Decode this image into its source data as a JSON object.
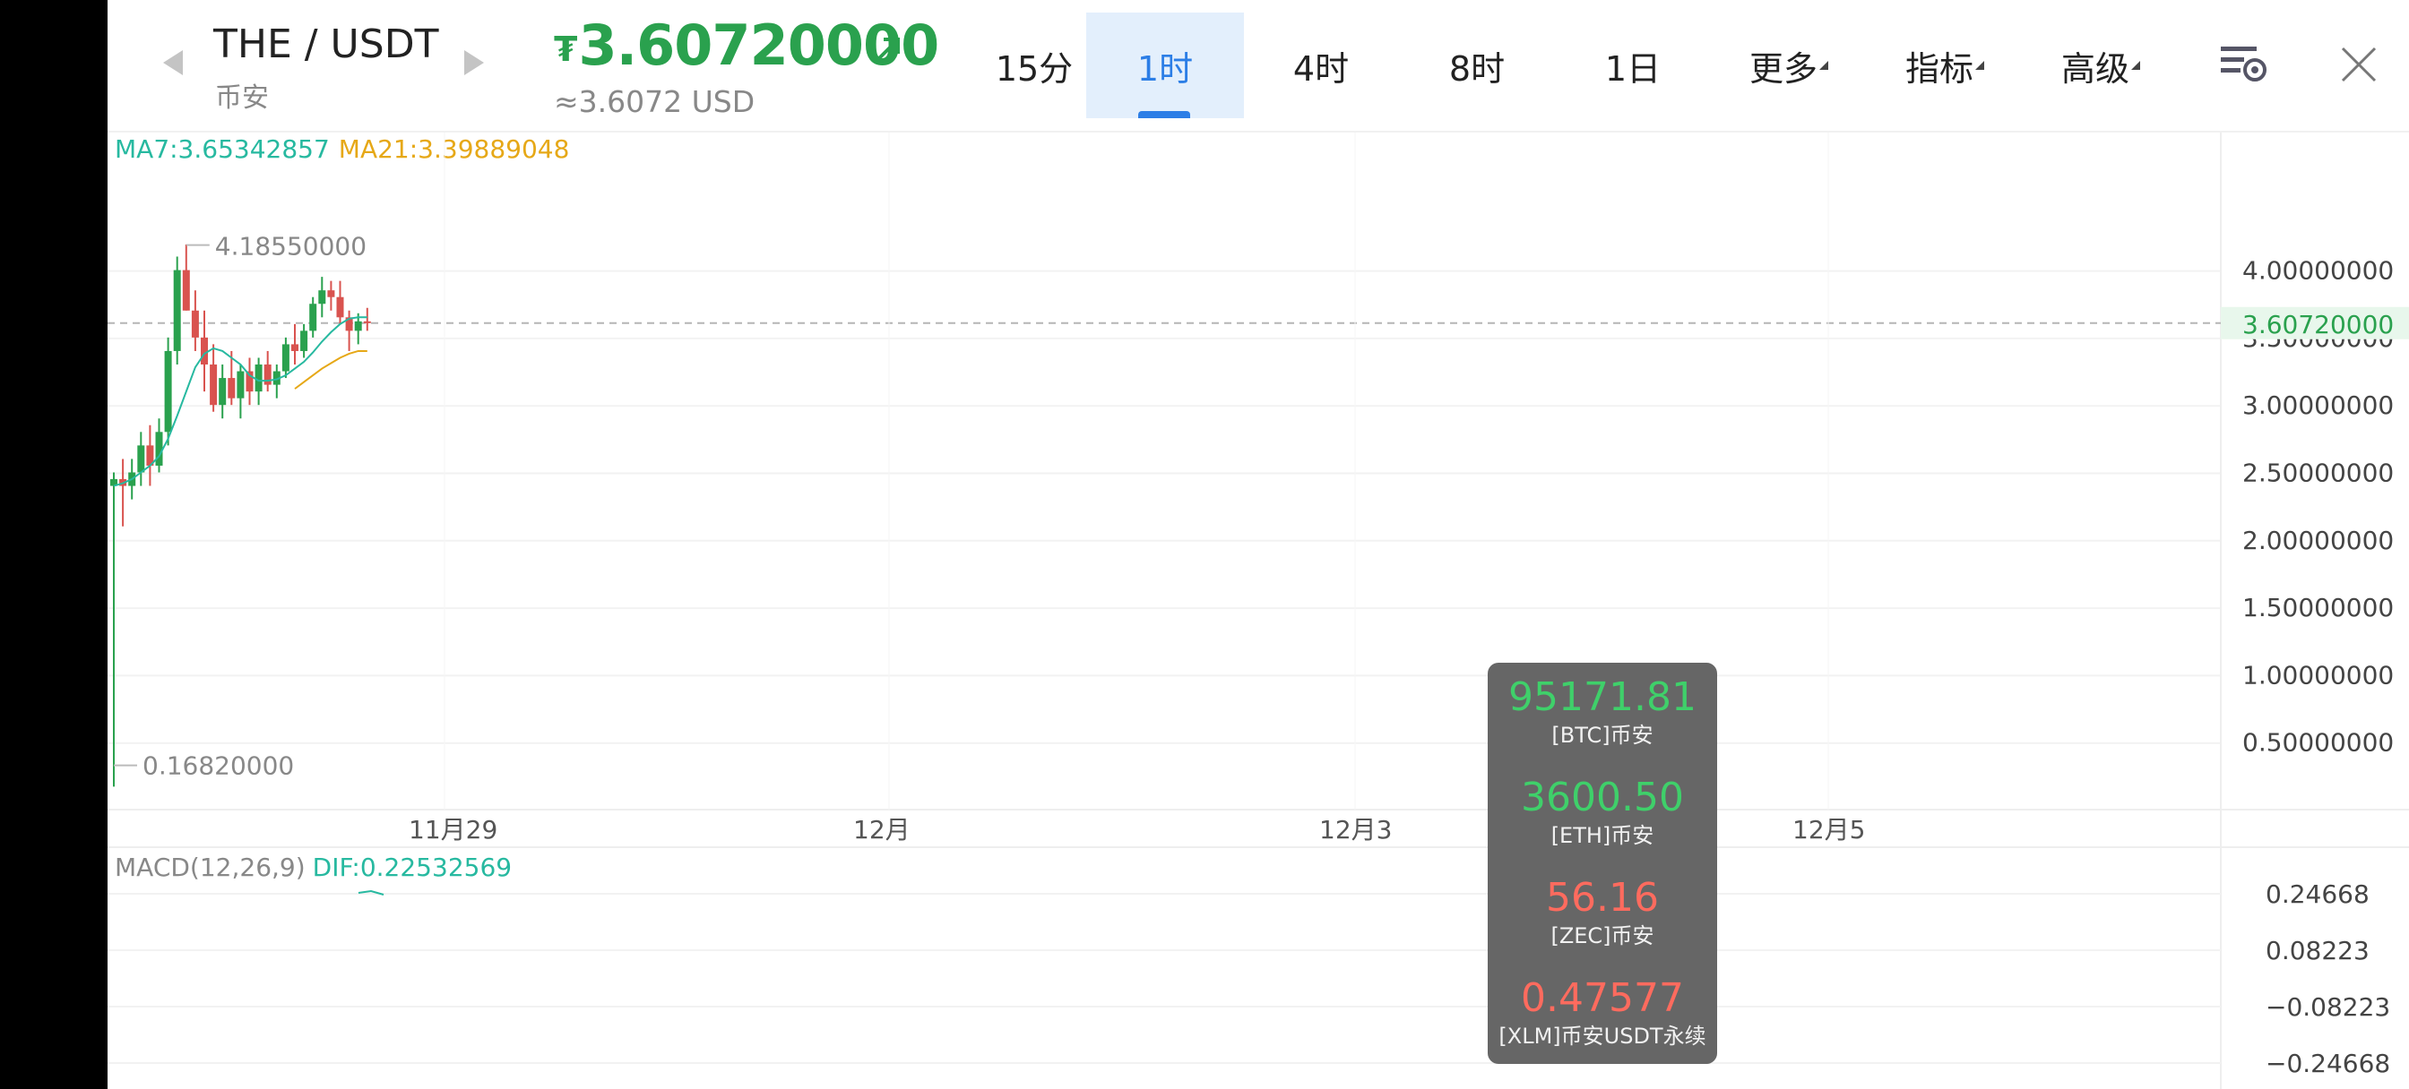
{
  "header": {
    "pair": "THE / USDT",
    "exchange": "币安",
    "price_symbol": "₮",
    "price": "3.60720000",
    "price_usd": "≈3.6072 USD"
  },
  "timeframes": [
    {
      "label": "15分",
      "active": false
    },
    {
      "label": "1时",
      "active": true
    },
    {
      "label": "4时",
      "active": false
    },
    {
      "label": "8时",
      "active": false
    },
    {
      "label": "1日",
      "active": false
    }
  ],
  "menus": {
    "more": "更多",
    "indicators": "指标",
    "advanced": "高级"
  },
  "icons": {
    "settings": "chart-settings-icon",
    "close": "close-icon",
    "prev": "prev-pair-icon",
    "next": "next-pair-icon",
    "trend": "trend-up-arrow-icon"
  },
  "indicators": {
    "ma7": "MA7:3.65342857",
    "ma21": "MA21:3.39889048",
    "macd": "MACD(12,26,9)",
    "dif": "DIF:0.22532569"
  },
  "chart_data": {
    "type": "candlestick",
    "price_axis": {
      "ticks": [
        "4.00000000",
        "3.50000000",
        "3.00000000",
        "2.50000000",
        "2.00000000",
        "1.50000000",
        "1.00000000",
        "0.50000000"
      ],
      "current": "3.60720000"
    },
    "high_label": "4.18550000",
    "low_label": "0.16820000",
    "x_labels": [
      "11月29",
      "12月",
      "12月3",
      "12月5"
    ],
    "macd_axis": [
      "0.24668",
      "0.08223",
      "−0.08223",
      "−0.24668"
    ],
    "colors": {
      "up": "#2aa14e",
      "down": "#d9534f",
      "ma7": "#27b9a0",
      "ma21": "#e6a817"
    },
    "candles": [
      {
        "o": 2.4,
        "h": 2.5,
        "l": 0.17,
        "c": 2.45
      },
      {
        "o": 2.45,
        "h": 2.6,
        "l": 2.1,
        "c": 2.4
      },
      {
        "o": 2.4,
        "h": 2.6,
        "l": 2.3,
        "c": 2.5
      },
      {
        "o": 2.5,
        "h": 2.8,
        "l": 2.4,
        "c": 2.7
      },
      {
        "o": 2.7,
        "h": 2.85,
        "l": 2.4,
        "c": 2.55
      },
      {
        "o": 2.55,
        "h": 2.9,
        "l": 2.5,
        "c": 2.8
      },
      {
        "o": 2.8,
        "h": 3.5,
        "l": 2.7,
        "c": 3.4
      },
      {
        "o": 3.4,
        "h": 4.1,
        "l": 3.3,
        "c": 4.0
      },
      {
        "o": 4.0,
        "h": 4.19,
        "l": 3.7,
        "c": 3.7
      },
      {
        "o": 3.7,
        "h": 3.85,
        "l": 3.4,
        "c": 3.5
      },
      {
        "o": 3.5,
        "h": 3.7,
        "l": 3.1,
        "c": 3.3
      },
      {
        "o": 3.3,
        "h": 3.45,
        "l": 2.95,
        "c": 3.0
      },
      {
        "o": 3.0,
        "h": 3.3,
        "l": 2.9,
        "c": 3.2
      },
      {
        "o": 3.2,
        "h": 3.4,
        "l": 3.0,
        "c": 3.05
      },
      {
        "o": 3.05,
        "h": 3.3,
        "l": 2.9,
        "c": 3.25
      },
      {
        "o": 3.25,
        "h": 3.35,
        "l": 3.0,
        "c": 3.1
      },
      {
        "o": 3.1,
        "h": 3.35,
        "l": 3.0,
        "c": 3.3
      },
      {
        "o": 3.3,
        "h": 3.4,
        "l": 3.1,
        "c": 3.15
      },
      {
        "o": 3.15,
        "h": 3.3,
        "l": 3.05,
        "c": 3.25
      },
      {
        "o": 3.25,
        "h": 3.5,
        "l": 3.2,
        "c": 3.45
      },
      {
        "o": 3.45,
        "h": 3.6,
        "l": 3.3,
        "c": 3.4
      },
      {
        "o": 3.4,
        "h": 3.6,
        "l": 3.35,
        "c": 3.55
      },
      {
        "o": 3.55,
        "h": 3.8,
        "l": 3.5,
        "c": 3.75
      },
      {
        "o": 3.75,
        "h": 3.95,
        "l": 3.65,
        "c": 3.85
      },
      {
        "o": 3.85,
        "h": 3.92,
        "l": 3.7,
        "c": 3.8
      },
      {
        "o": 3.8,
        "h": 3.92,
        "l": 3.6,
        "c": 3.65
      },
      {
        "o": 3.65,
        "h": 3.7,
        "l": 3.4,
        "c": 3.55
      },
      {
        "o": 3.55,
        "h": 3.68,
        "l": 3.45,
        "c": 3.62
      },
      {
        "o": 3.62,
        "h": 3.72,
        "l": 3.55,
        "c": 3.61
      }
    ],
    "ma7": [
      2.4,
      2.42,
      2.45,
      2.5,
      2.55,
      2.62,
      2.75,
      2.92,
      3.1,
      3.28,
      3.38,
      3.42,
      3.4,
      3.35,
      3.3,
      3.22,
      3.18,
      3.18,
      3.19,
      3.22,
      3.27,
      3.32,
      3.39,
      3.47,
      3.54,
      3.6,
      3.64,
      3.65,
      3.65
    ],
    "ma21": [
      null,
      null,
      null,
      null,
      null,
      null,
      null,
      null,
      null,
      null,
      null,
      null,
      null,
      null,
      null,
      null,
      null,
      null,
      null,
      null,
      3.12,
      3.17,
      3.22,
      3.27,
      3.31,
      3.35,
      3.38,
      3.4,
      3.4
    ],
    "dif": [
      0.21,
      0.22,
      0.23,
      0.23,
      0.23
    ]
  },
  "tooltip": [
    {
      "value": "95171.81",
      "name": "[BTC]币安",
      "trend": "up"
    },
    {
      "value": "3600.50",
      "name": "[ETH]币安",
      "trend": "up"
    },
    {
      "value": "56.16",
      "name": "[ZEC]币安",
      "trend": "down"
    },
    {
      "value": "0.47577",
      "name": "[XLM]币安USDT永续",
      "trend": "down"
    }
  ]
}
